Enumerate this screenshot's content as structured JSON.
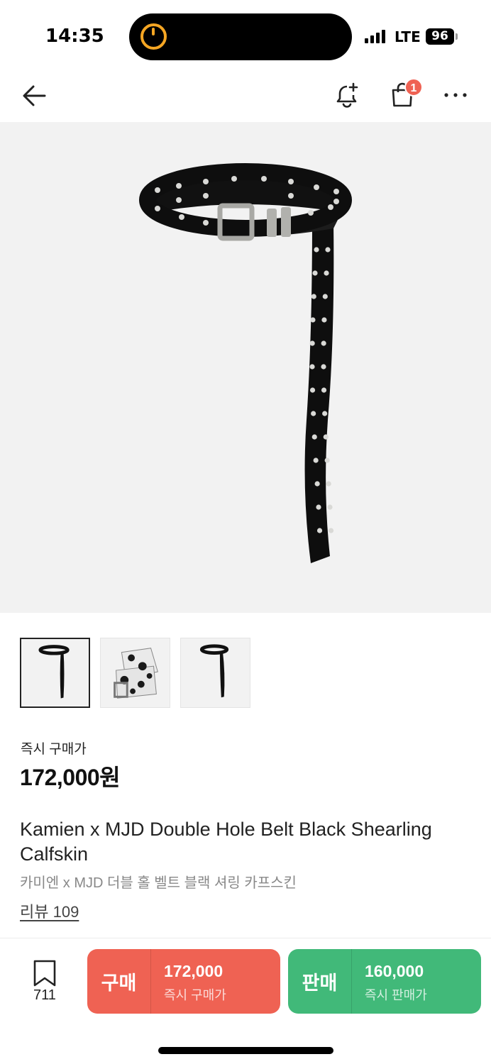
{
  "status": {
    "time": "14:35",
    "network": "LTE",
    "battery": "96"
  },
  "nav": {
    "cart_badge": "1"
  },
  "price": {
    "label": "즉시 구매가",
    "value": "172,000원"
  },
  "product": {
    "name": "Kamien x MJD Double Hole Belt Black Shearling Calfskin",
    "name_kr": "카미엔 x MJD 더블 홀 벨트 블랙 셔링 카프스킨",
    "review_link": "리뷰 109"
  },
  "bottom": {
    "wish_count": "711",
    "buy": {
      "label": "구매",
      "price": "172,000",
      "sub": "즉시 구매가",
      "color": "#ef6253"
    },
    "sell": {
      "label": "판매",
      "price": "160,000",
      "sub": "즉시 판매가",
      "color": "#41b979"
    }
  }
}
